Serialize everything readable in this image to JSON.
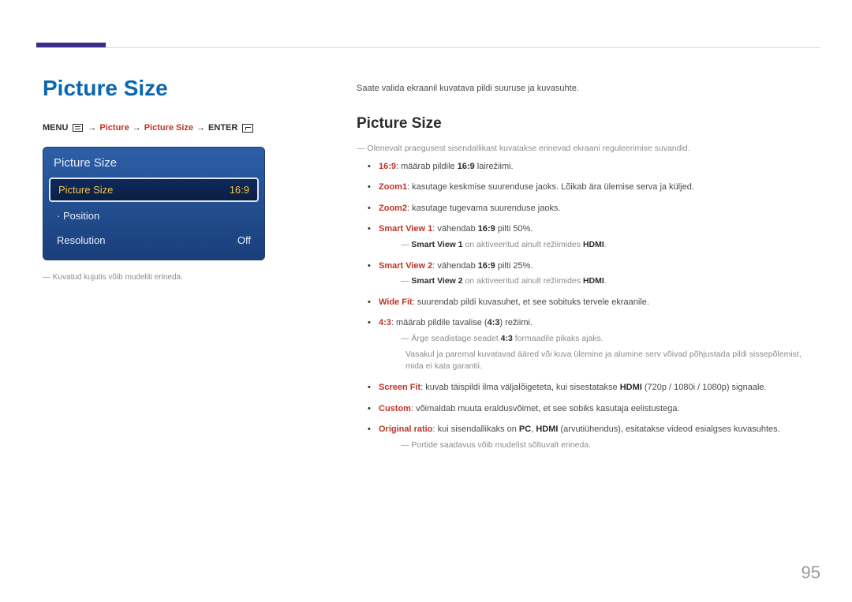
{
  "page_number": "95",
  "left": {
    "heading": "Picture Size",
    "breadcrumb": {
      "menu": "MENU",
      "arrow": "→",
      "picture": "Picture",
      "picture_size": "Picture Size",
      "enter": "ENTER"
    },
    "osd": {
      "title": "Picture Size",
      "rows": [
        {
          "label": "Picture Size",
          "value": "16:9",
          "selected": true
        },
        {
          "label": "· Position",
          "value": "",
          "selected": false
        },
        {
          "label": "Resolution",
          "value": "Off",
          "selected": false
        }
      ]
    },
    "note": "Kuvatud kujutis võib mudeliti erineda."
  },
  "right": {
    "intro": "Saate valida ekraanil kuvatava pildi suuruse ja kuvasuhte.",
    "heading": "Picture Size",
    "note_top": "Olenevalt praegusest sisendallikast kuvatakse erinevad ekraani reguleerimise suvandid.",
    "items": [
      {
        "lead": "16:9",
        "text": ": määrab pildile ",
        "mid_bold": "16:9",
        "tail": " lairežiimi."
      },
      {
        "lead": "Zoom1",
        "text": ": kasutage keskmise suurenduse jaoks. Lõikab ära ülemise serva ja küljed."
      },
      {
        "lead": "Zoom2",
        "text": ": kasutage tugevama suurenduse jaoks."
      },
      {
        "lead": "Smart View 1",
        "text": ": vähendab ",
        "mid_bold": "16:9",
        "tail": " pilti 50%.",
        "sub": {
          "pre": "",
          "bold1": "Smart View 1",
          "mid": " on aktiveeritud ainult režiimides ",
          "bold2": "HDMI",
          "post": "."
        }
      },
      {
        "lead": "Smart View 2",
        "text": ": vähendab ",
        "mid_bold": "16:9",
        "tail": " pilti 25%.",
        "sub": {
          "pre": "",
          "bold1": "Smart View 2",
          "mid": " on aktiveeritud ainult režiimides ",
          "bold2": "HDMI",
          "post": "."
        }
      },
      {
        "lead": "Wide Fit",
        "text": ": suurendab pildi kuvasuhet, et see sobituks tervele ekraanile."
      },
      {
        "lead": "4:3",
        "text": ": määrab pildile tavalise (",
        "mid_bold": "4:3",
        "tail": ") režiimi.",
        "sub_plain": {
          "line1_pre": "Ärge seadistage seadet ",
          "line1_bold": "4:3",
          "line1_post": " formaadile pikaks ajaks.",
          "line2": "Vasakul ja paremal kuvatavad ääred või kuva ülemine ja alumine serv võivad põhjustada pildi sissepõlemist, mida ei kata garantii."
        }
      },
      {
        "lead": "Screen Fit",
        "text": ": kuvab täispildi ilma väljalõigeteta, kui sisestatakse ",
        "mid_bold": "HDMI",
        "tail": " (720p / 1080i / 1080p) signaale."
      },
      {
        "lead": "Custom",
        "text": ": võimaldab muuta eraldusvõimet, et see sobiks kasutaja eelistustega."
      },
      {
        "lead": "Original ratio",
        "text": ": kui sisendallikaks on ",
        "mid_bold": "PC",
        "tail_mid": ", ",
        "mid_bold2": "HDMI",
        "tail": " (arvutiühendus), esitatakse videod esialgses kuvasuhtes.",
        "sub_plain_simple": "Portide saadavus võib mudelist sõltuvalt erineda."
      }
    ]
  }
}
